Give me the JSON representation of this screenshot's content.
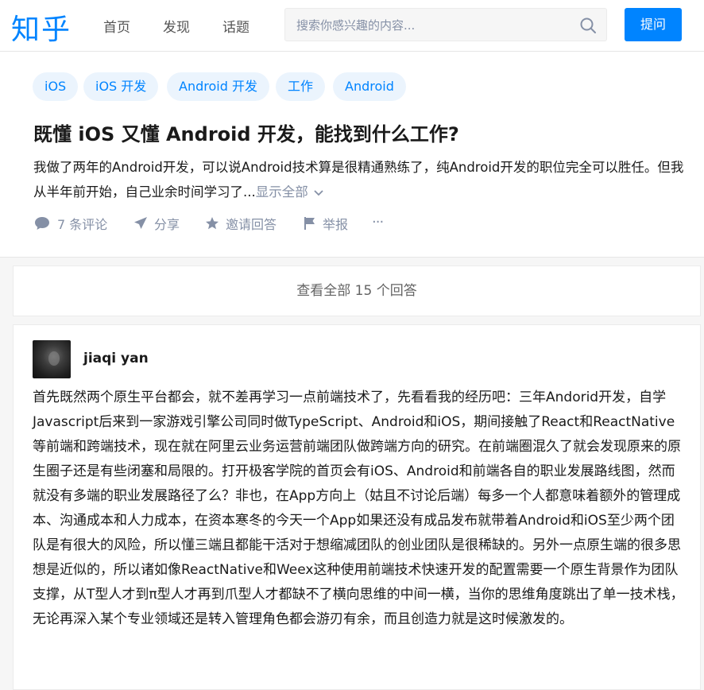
{
  "header": {
    "logo": "知乎",
    "nav": [
      "首页",
      "发现",
      "话题"
    ],
    "search_placeholder": "搜索你感兴趣的内容...",
    "ask_label": "提问"
  },
  "question": {
    "topics": [
      "iOS",
      "iOS 开发",
      "Android 开发",
      "工作",
      "Android"
    ],
    "title": "既懂 iOS 又懂 Android 开发，能找到什么工作?",
    "excerpt": "我做了两年的Android开发，可以说Android技术算是很精通熟练了，纯Android开发的职位完全可以胜任。但我从半年前开始，自己业余时间学习了...",
    "show_all": "显示全部",
    "actions": {
      "comments": "7 条评论",
      "share": "分享",
      "invite": "邀请回答",
      "report": "举报",
      "more": "···"
    }
  },
  "view_all_answers": "查看全部 15 个回答",
  "answer": {
    "author": "jiaqi yan",
    "content": "首先既然两个原生平台都会，就不差再学习一点前端技术了，先看看我的经历吧：三年Andorid开发，自学Javascript后来到一家游戏引擎公司同时做TypeScript、Android和iOS，期间接触了React和ReactNative等前端和跨端技术，现在就在阿里云业务运营前端团队做跨端方向的研究。在前端圈混久了就会发现原来的原生圈子还是有些闭塞和局限的。打开极客学院的首页会有iOS、Android和前端各自的职业发展路线图，然而就没有多端的职业发展路径了么？非也，在App方向上（姑且不讨论后端）每多一个人都意味着额外的管理成本、沟通成本和人力成本，在资本寒冬的今天一个App如果还没有成品发布就带着Android和iOS至少两个团队是有很大的风险，所以懂三端且都能干活对于想缩减团队的创业团队是很稀缺的。另外一点原生端的很多思想是近似的，所以诸如像ReactNative和Weex这种使用前端技术快速开发的配置需要一个原生背景作为团队支撑，从T型人才到π型人才再到爪型人才都缺不了横向思维的中间一横，当你的思维角度跳出了单一技术栈，无论再深入某个专业领域还是转入管理角色都会游刃有余，而且创造力就是这时候激发的。"
  },
  "colors": {
    "brand": "#0084ff",
    "tag_bg": "#ebf4fd",
    "muted": "#8590a6",
    "page_bg": "#f6f6f6"
  }
}
